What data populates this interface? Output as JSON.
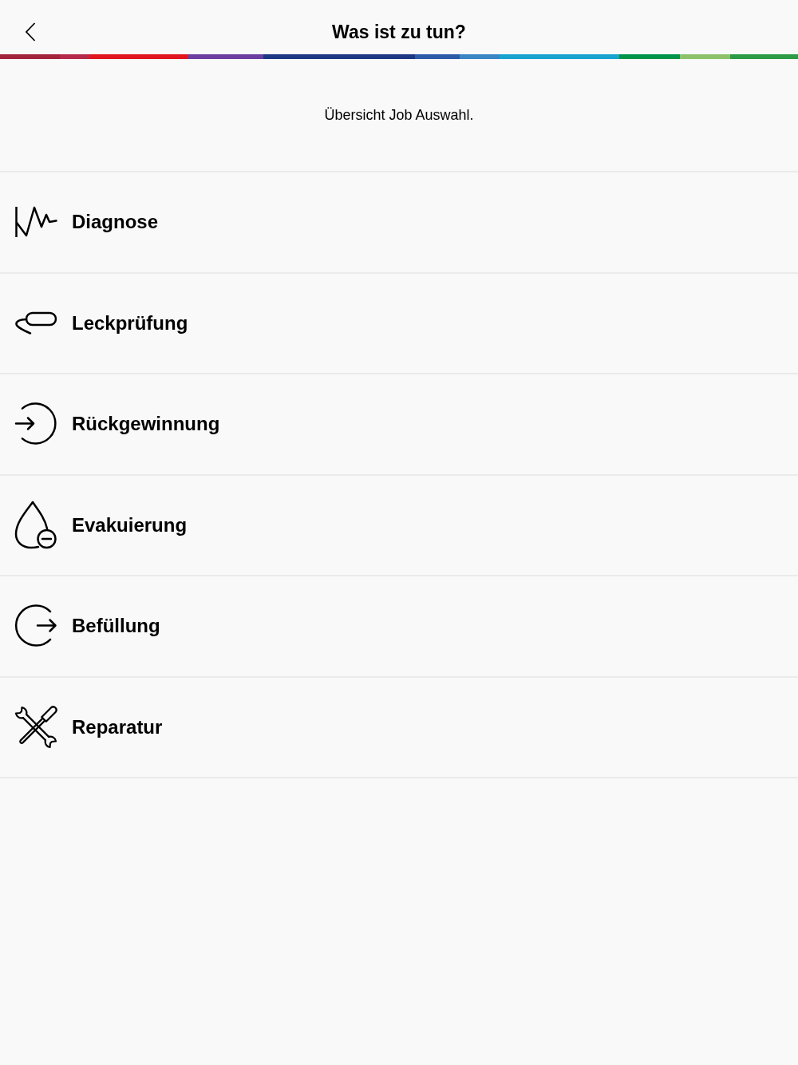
{
  "header": {
    "title": "Was ist zu tun?"
  },
  "subtitle": "Übersicht Job Auswahl.",
  "jobs": [
    {
      "label": "Diagnose",
      "kind": "pulse"
    },
    {
      "label": "Leckprüfung",
      "kind": "probe"
    },
    {
      "label": "Rückgewinnung",
      "kind": "arrow-in"
    },
    {
      "label": "Evakuierung",
      "kind": "drop-minus"
    },
    {
      "label": "Befüllung",
      "kind": "arrow-out"
    },
    {
      "label": "Reparatur",
      "kind": "tools"
    }
  ]
}
